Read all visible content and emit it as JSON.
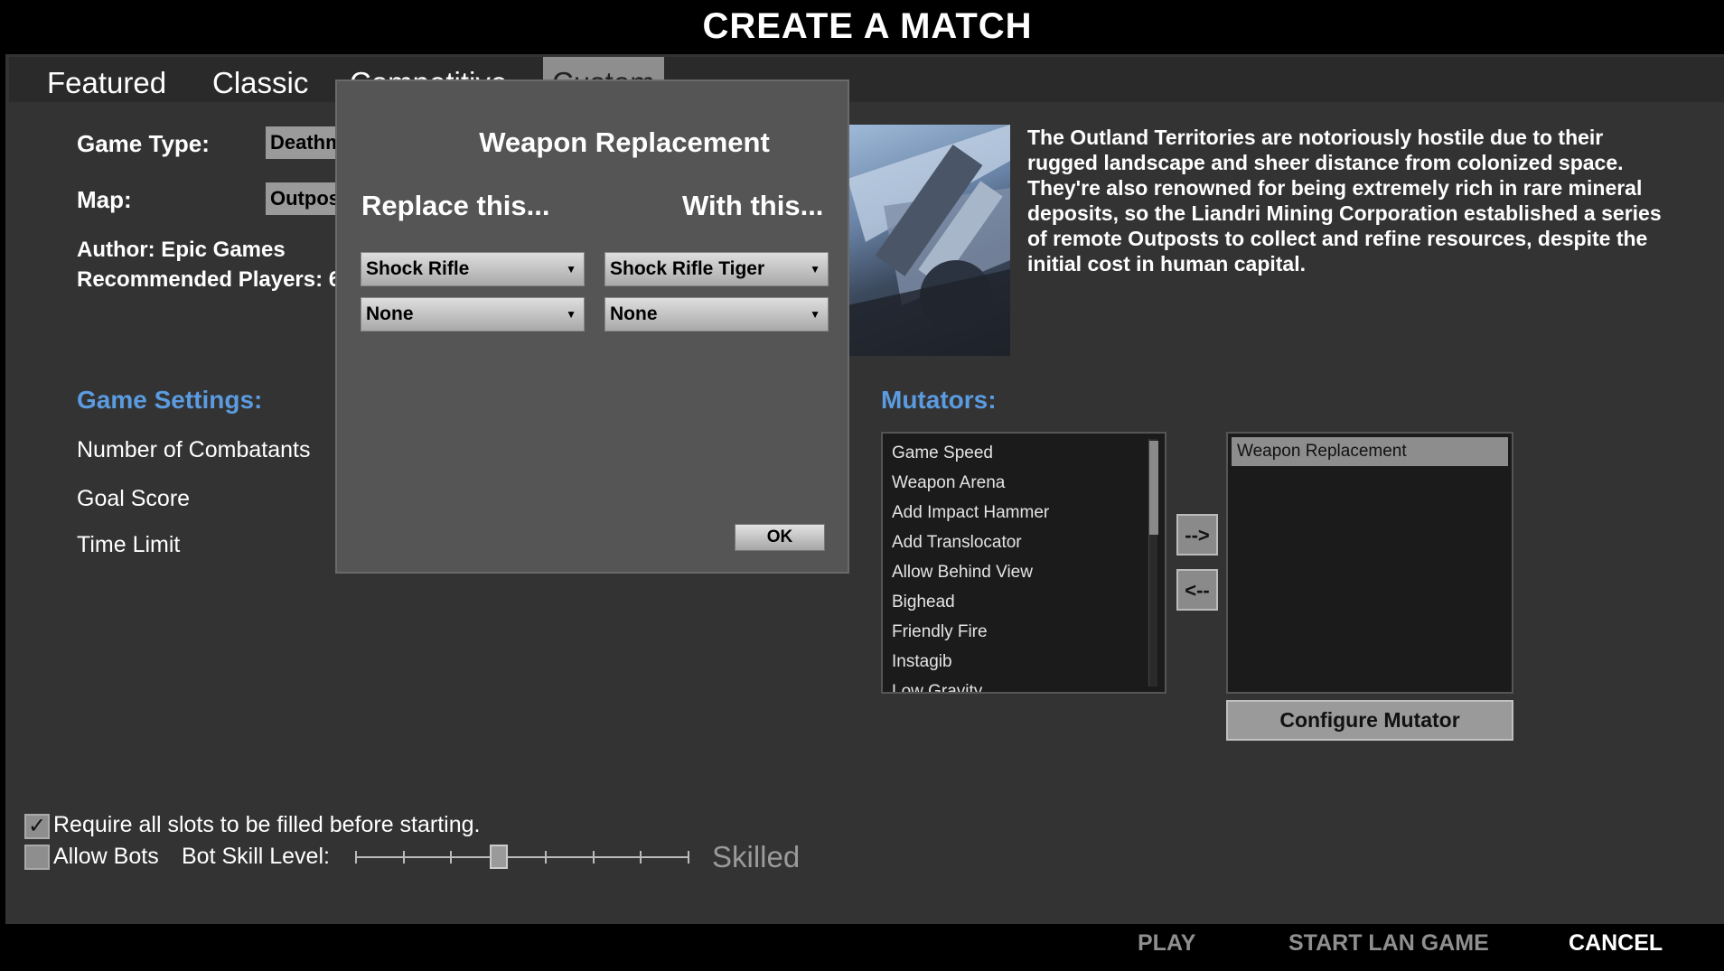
{
  "title": "CREATE A MATCH",
  "tabs": [
    {
      "label": "Featured",
      "active": false
    },
    {
      "label": "Classic",
      "active": false
    },
    {
      "label": "Competitive",
      "active": false
    },
    {
      "label": "Custom",
      "active": true
    }
  ],
  "match": {
    "game_type_label": "Game Type:",
    "game_type_value": "Deathmatch",
    "map_label": "Map:",
    "map_value": "Outpost",
    "author": "Author: Epic Games",
    "recommended_players": "Recommended Players: 6",
    "description": "The Outland Territories are notoriously hostile due to their rugged landscape and sheer distance from colonized space. They're also renowned for being extremely rich in rare mineral deposits, so the Liandri Mining Corporation established a series of remote Outposts to collect and refine resources, despite the initial cost in human capital."
  },
  "game_settings": {
    "heading": "Game Settings:",
    "items": [
      "Number of Combatants",
      "Goal Score",
      "Time Limit"
    ]
  },
  "mutators": {
    "heading": "Mutators:",
    "available": [
      "Game Speed",
      "Weapon Arena",
      "Add Impact Hammer",
      "Add Translocator",
      "Allow Behind View",
      "Bighead",
      "Friendly Fire",
      "Instagib",
      "Low Gravity"
    ],
    "enabled": [
      "Weapon Replacement"
    ],
    "add_label": "-->",
    "remove_label": "<--",
    "configure_label": "Configure Mutator"
  },
  "options": {
    "require_slots_label": "Require all slots to be filled before starting.",
    "require_slots_checked": true,
    "allow_bots_label": "Allow Bots",
    "allow_bots_checked": false,
    "bot_skill_label": "Bot Skill Level:",
    "bot_skill_value": "Skilled",
    "bot_skill_level_fraction": 0.43
  },
  "footer": {
    "play": "PLAY",
    "start_lan": "START LAN GAME",
    "cancel": "CANCEL"
  },
  "dialog": {
    "title": "Weapon Replacement",
    "replace_heading": "Replace this...",
    "with_heading": "With this...",
    "rows": [
      {
        "replace": "Shock Rifle",
        "with": "Shock Rifle Tiger"
      },
      {
        "replace": "None",
        "with": "None"
      }
    ],
    "ok_label": "OK"
  },
  "colors": {
    "accent_blue": "#5b9be0",
    "panel": "#333333",
    "dialog": "#555555"
  }
}
